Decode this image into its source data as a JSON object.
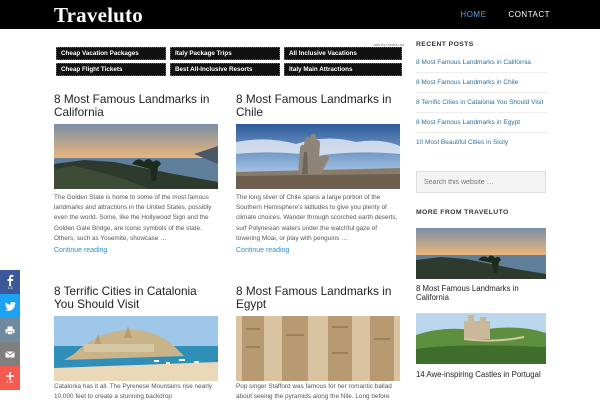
{
  "header": {
    "logo": "Traveluto",
    "nav": [
      {
        "label": "HOME",
        "active": true
      },
      {
        "label": "CONTACT",
        "active": false
      }
    ]
  },
  "ads": {
    "note": "ads by media.net",
    "buttons": [
      "Cheap Vacation Packages",
      "Italy Package Trips",
      "All Inclusive Vacations",
      "Cheap Flight Tickets",
      "Best All-Inclusive Resorts",
      "Italy Main Attractions"
    ]
  },
  "posts": [
    {
      "title": "8 Most Famous Landmarks in California",
      "excerpt": "The Golden State is home to some of the most famous landmarks and attractions in the United States, possibly even the world. Some, like the Hollywood Sign and the Golden Gate Bridge, are iconic symbols of the state. Others, such as Yosemite, showcase …",
      "more": "Continue reading"
    },
    {
      "title": "8 Most Famous Landmarks in Chile",
      "excerpt": "The long sliver of Chile spans a large portion of the Southern Hemisphere's latitudes to give you plenty of climate choices. Wander through scorched earth deserts, surf Polynesian waters under the watchful gaze of towering Moai, or play with penguins …",
      "more": "Continue reading"
    },
    {
      "title": "8 Terrific Cities in Catalonia You Should Visit",
      "excerpt": "Catalonia has it all. The Pyrenese Mountains rise nearly 10,000 feet to create a stunning backdrop"
    },
    {
      "title": "8 Most Famous Landmarks in Egypt",
      "excerpt": "Pop singer Stafford was famous for her romantic ballad about seeing the pyramids along the Nile. Long before"
    }
  ],
  "sidebar": {
    "recent_heading": "RECENT POSTS",
    "recent_posts": [
      "8 Most Famous Landmarks in California",
      "8 Most Famous Landmarks in Chile",
      "8 Terrific Cities in Catalonia You Should Visit",
      "8 Most Famous Landmarks in Egypt",
      "10 Most Beautiful Cities in Sicily"
    ],
    "search_placeholder": "Search this website …",
    "more_heading": "MORE FROM TRAVELUTO",
    "more_posts": [
      "8 Most Famous Landmarks in California",
      "14 Awe-inspiring Castles in Portugal"
    ]
  },
  "share": {
    "facebook_count": "1.3",
    "plus_count": "1.3K"
  },
  "colors": {
    "header_bg": "#000000",
    "nav_active": "#4aa3df",
    "link": "#2a8fd0",
    "facebook": "#3b5998",
    "twitter": "#1da1f2",
    "print": "#6d8a9e",
    "email": "#7f7f7f",
    "plus": "#f55a4e"
  }
}
